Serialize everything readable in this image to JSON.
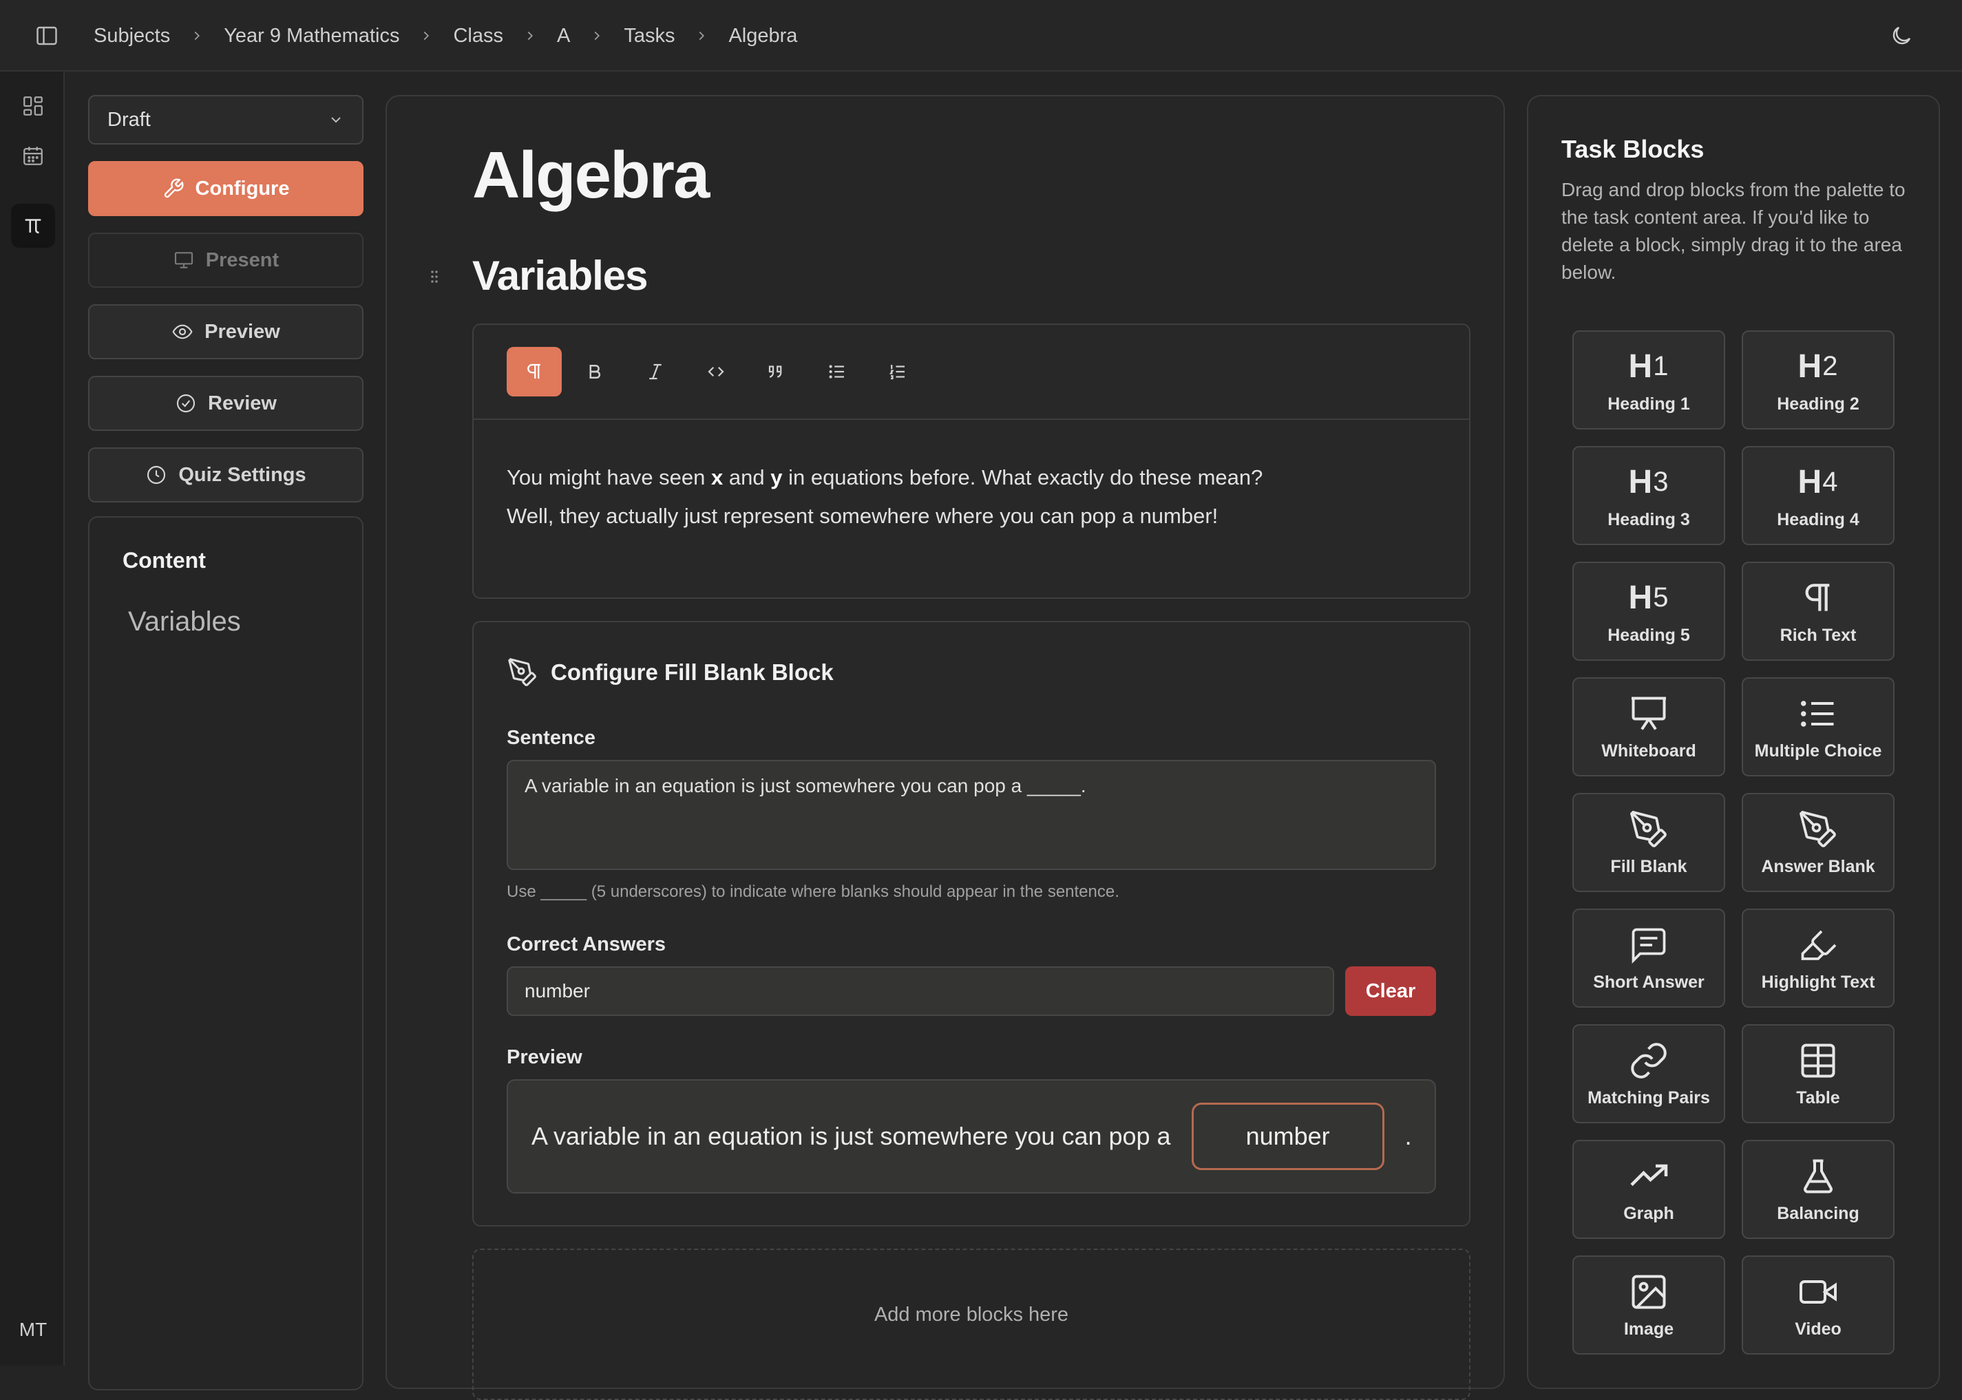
{
  "breadcrumb": [
    "Subjects",
    "Year 9 Mathematics",
    "Class",
    "A",
    "Tasks",
    "Algebra"
  ],
  "rail": {
    "avatar_initials": "MT"
  },
  "left": {
    "status_value": "Draft",
    "buttons": {
      "configure": "Configure",
      "present": "Present",
      "preview": "Preview",
      "review": "Review",
      "quiz_settings": "Quiz Settings"
    },
    "content_title": "Content",
    "content_items": [
      "Variables"
    ]
  },
  "main": {
    "title": "Algebra",
    "section_heading": "Variables",
    "editor": {
      "line1_a": "You might have seen ",
      "line1_x": "x",
      "line1_and": " and ",
      "line1_y": "y",
      "line1_b": " in equations before. What exactly do these mean?",
      "line2": "Well, they actually just represent somewhere where you can pop a number!"
    },
    "config": {
      "title": "Configure Fill Blank Block",
      "sentence_label": "Sentence",
      "sentence_value": "A variable in an equation is just somewhere you can pop a _____.",
      "hint": "Use _____ (5 underscores) to indicate where blanks should appear in the sentence.",
      "answers_label": "Correct Answers",
      "answer_value": "number",
      "clear_label": "Clear",
      "preview_label": "Preview",
      "preview_text": "A variable in an equation is just somewhere you can pop a",
      "preview_blank": "number",
      "preview_end": "."
    },
    "dropzone_text": "Add more blocks here"
  },
  "palette": {
    "title": "Task Blocks",
    "description": "Drag and drop blocks from the palette to the task content area. If you'd like to delete a block, simply drag it to the area below.",
    "blocks": [
      {
        "label": "Heading 1",
        "icon": "heading-1-icon"
      },
      {
        "label": "Heading 2",
        "icon": "heading-2-icon"
      },
      {
        "label": "Heading 3",
        "icon": "heading-3-icon"
      },
      {
        "label": "Heading 4",
        "icon": "heading-4-icon"
      },
      {
        "label": "Heading 5",
        "icon": "heading-5-icon"
      },
      {
        "label": "Rich Text",
        "icon": "pilcrow-icon"
      },
      {
        "label": "Whiteboard",
        "icon": "presentation-icon"
      },
      {
        "label": "Multiple Choice",
        "icon": "list-icon"
      },
      {
        "label": "Fill Blank",
        "icon": "pen-tool-icon"
      },
      {
        "label": "Answer Blank",
        "icon": "pen-tool-icon"
      },
      {
        "label": "Short Answer",
        "icon": "message-square-text-icon"
      },
      {
        "label": "Highlight Text",
        "icon": "highlighter-icon"
      },
      {
        "label": "Matching Pairs",
        "icon": "link-icon"
      },
      {
        "label": "Table",
        "icon": "table-icon"
      },
      {
        "label": "Graph",
        "icon": "trending-up-icon"
      },
      {
        "label": "Balancing",
        "icon": "flask-icon"
      },
      {
        "label": "Image",
        "icon": "image-icon"
      },
      {
        "label": "Video",
        "icon": "video-icon"
      }
    ]
  },
  "colors": {
    "accent": "#e0785a",
    "danger": "#b03a3a",
    "background": "#242424"
  }
}
